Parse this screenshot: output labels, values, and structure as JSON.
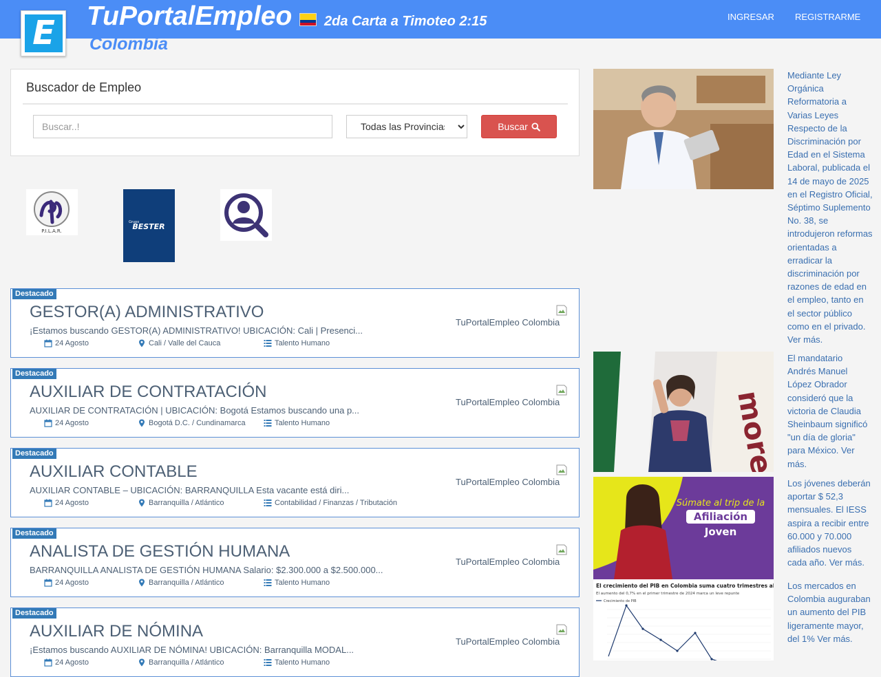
{
  "header": {
    "logo_letter": "E",
    "brand": "TuPortalEmpleo",
    "verse": "2da Carta a Timoteo 2:15",
    "country": "Colombia",
    "nav": {
      "login": "INGRESAR",
      "register": "REGISTRARME"
    },
    "flag_colors": [
      "#fcd116",
      "#003893",
      "#ce1126"
    ]
  },
  "search": {
    "title": "Buscador de Empleo",
    "placeholder": "Buscar..!",
    "province_selected": "Todas las Provincias",
    "button_label": "Buscar"
  },
  "companies": [
    "P.I.L.A.R.",
    "BESTER",
    "Grupo"
  ],
  "jobs": [
    {
      "badge": "Destacado",
      "title": "GESTOR(A) ADMINISTRATIVO",
      "description": "¡Estamos buscando GESTOR(A) ADMINISTRATIVO! UBICACIÓN: Cali | Presenci...",
      "date": "24 Agosto",
      "location": "Cali / Valle del Cauca",
      "category": "Talento Humano",
      "company": "TuPortalEmpleo Colombia"
    },
    {
      "badge": "Destacado",
      "title": "AUXILIAR DE CONTRATACIÓN",
      "description": "AUXILIAR DE CONTRATACIÓN | UBICACIÓN: Bogotá Estamos buscando una p...",
      "date": "24 Agosto",
      "location": "Bogotá D.C. / Cundinamarca",
      "category": "Talento Humano",
      "company": "TuPortalEmpleo Colombia"
    },
    {
      "badge": "Destacado",
      "title": "AUXILIAR CONTABLE",
      "description": "AUXILIAR CONTABLE – UBICACIÓN: BARRANQUILLA Esta vacante está diri...",
      "date": "24 Agosto",
      "location": "Barranquilla / Atlántico",
      "category": "Contabilidad / Finanzas / Tributación",
      "company": "TuPortalEmpleo Colombia"
    },
    {
      "badge": "Destacado",
      "title": "ANALISTA DE GESTIÓN HUMANA",
      "description": "BARRANQUILLA ANALISTA DE GESTIÓN HUMANA Salario: $2.300.000 a $2.500.000...",
      "date": "24 Agosto",
      "location": "Barranquilla / Atlántico",
      "category": "Talento Humano",
      "company": "TuPortalEmpleo Colombia"
    },
    {
      "badge": "Destacado",
      "title": "AUXILIAR DE NÓMINA",
      "description": "¡Estamos buscando AUXILIAR DE NÓMINA! UBICACIÓN: Barranquilla MODAL...",
      "date": "24 Agosto",
      "location": "Barranquilla / Atlántico",
      "category": "Talento Humano",
      "company": "TuPortalEmpleo Colombia"
    }
  ],
  "news": [
    {
      "text": "Mediante Ley Orgánica Reformatoria a Varias Leyes Respecto de la Discriminación por Edad en el Sistema Laboral, publicada el 14 de mayo de 2025 en el Registro Oficial, Séptimo Suplemento No. 38, se introdujeron reformas orientadas a erradicar la discriminación por razones de edad en el empleo, tanto en el sector público como en el privado. Ver más."
    },
    {
      "text": "El mandatario Andrés Manuel López Obrador consideró que la victoria de Claudia Sheinbaum significó \"un día de gloria\" para México. Ver más.",
      "img_word": "more"
    },
    {
      "text": "Los jóvenes deberán aportar $ 52,3 mensuales. El IESS aspira a recibir entre 60.000 y 70.000 afiliados nuevos cada año. Ver más.",
      "img_line1": "Súmate al trip de la",
      "img_line2": "Afiliación",
      "img_line3": "Joven"
    },
    {
      "text": "Los mercados en Colombia auguraban un aumento del PIB ligeramente mayor, del 1% Ver más.",
      "img_title": "El crecimiento del PIB en Colombia suma cuatro trimestres abajo del",
      "img_subtitle": "El aumento del 0,7% en el primer trimestre de 2024 marca un leve repunte",
      "img_legend": "Crecimiento de PIB"
    }
  ]
}
